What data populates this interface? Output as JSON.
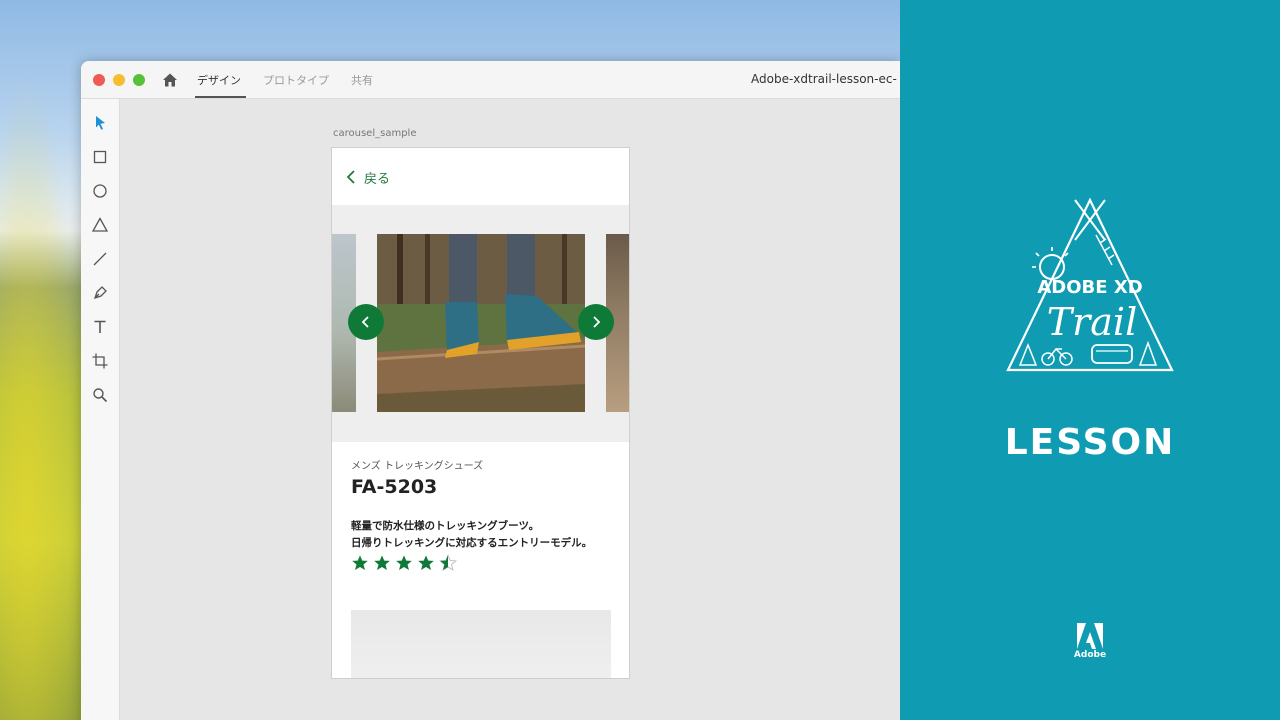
{
  "window": {
    "tabs": [
      {
        "label": "デザイン",
        "active": true
      },
      {
        "label": "プロトタイプ",
        "active": false
      },
      {
        "label": "共有",
        "active": false
      }
    ],
    "doc_title": "Adobe-xdtrail-lesson-ec-"
  },
  "toolbar": {
    "tools": [
      "select-icon",
      "rectangle-icon",
      "ellipse-icon",
      "polygon-icon",
      "line-icon",
      "pen-icon",
      "text-icon",
      "artboard-icon",
      "zoom-icon"
    ]
  },
  "artboard": {
    "label": "carousel_sample",
    "back_label": "戻る",
    "category": "メンズ トレッキングシューズ",
    "product_name": "FA-5203",
    "description_line1": "軽量で防水仕様のトレッキングブーツ。",
    "description_line2": "日帰りトレッキングに対応するエントリーモデル。",
    "rating": 4.5,
    "rating_max": 5
  },
  "brand": {
    "logo_text_line1": "ADOBE XD",
    "logo_text_line2": "Trail",
    "lesson_label": "LESSON",
    "adobe_label": "Adobe"
  },
  "colors": {
    "accent_green": "#0f7a37",
    "brand_teal": "#0f9bb2"
  }
}
